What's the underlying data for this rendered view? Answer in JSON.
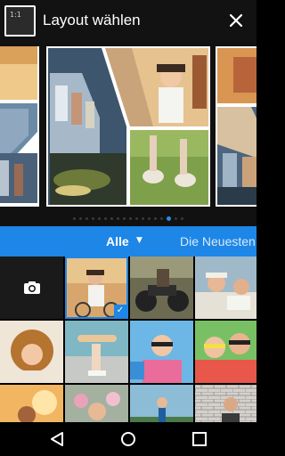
{
  "header": {
    "ratio_label": "1:1",
    "title": "Layout wählen",
    "close_icon": "close-icon"
  },
  "carousel": {
    "layouts": [
      "collage-left-partial",
      "collage-diagonal-selected",
      "collage-right-partial"
    ],
    "page_count": 18,
    "active_page": 15
  },
  "filter": {
    "all_label": "Alle",
    "newest_label": "Die Neuesten"
  },
  "grid": {
    "camera_icon": "camera-icon",
    "photos": [
      {
        "name": "photo-girl-bicycle",
        "selected": true
      },
      {
        "name": "photo-motorcycle",
        "selected": false
      },
      {
        "name": "photo-kids-reading",
        "selected": false
      },
      {
        "name": "photo-curly-girl",
        "selected": false
      },
      {
        "name": "photo-skateboard",
        "selected": false
      },
      {
        "name": "photo-couple-sunglasses",
        "selected": false
      },
      {
        "name": "photo-friends-sunglasses",
        "selected": false
      },
      {
        "name": "photo-couple-sunset",
        "selected": false
      },
      {
        "name": "photo-flowers-girl",
        "selected": false
      },
      {
        "name": "photo-runner",
        "selected": false
      },
      {
        "name": "photo-brick-wall",
        "selected": false
      }
    ]
  },
  "colors": {
    "accent": "#1d86e7",
    "header_bg": "#121212"
  }
}
